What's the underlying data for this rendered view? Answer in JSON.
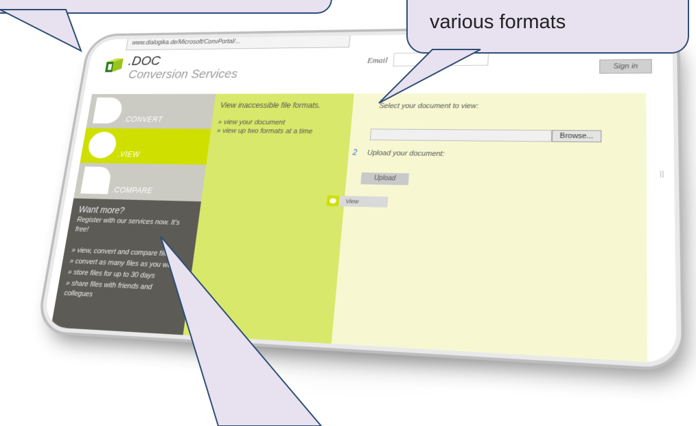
{
  "browser": {
    "url": "www.dialogika.de/Microsoft/ConvPortal/..."
  },
  "header": {
    "logo_title": ".DOC",
    "logo_subtitle": "Conversion Services",
    "email_label": "Email",
    "signin_label": "Sign in"
  },
  "nav": {
    "items": [
      {
        "label": ".CONVERT"
      },
      {
        "label": ".VIEW"
      },
      {
        "label": ".COMPARE"
      }
    ]
  },
  "promo": {
    "title": "Want more?",
    "subtitle": "Register with our services now. It's free!",
    "items": [
      "» view, convert and compare files",
      "» convert as many files as you want",
      "» store files for up to 30 days",
      "» share files with friends and collegues"
    ]
  },
  "view_panel": {
    "tagline": "View inaccessible file formats.",
    "bullets": [
      "» view your document",
      "» view up two formats at a time"
    ]
  },
  "upload_panel": {
    "select_label": "Select your document to view:",
    "browse_label": "Browse...",
    "step_number": "2",
    "upload_label": "Upload your document:",
    "upload_button": "Upload",
    "view_button": "View"
  },
  "callouts": {
    "right_text": "various formats"
  },
  "colors": {
    "accent_green": "#cfe000",
    "panel_green": "#d8e86a",
    "panel_pale": "#f7f8d2",
    "nav_gray": "#cbcbc3",
    "promo_dark": "#5c5b55",
    "bubble_fill": "#e7e1f0",
    "bubble_border": "#2f4e74"
  }
}
